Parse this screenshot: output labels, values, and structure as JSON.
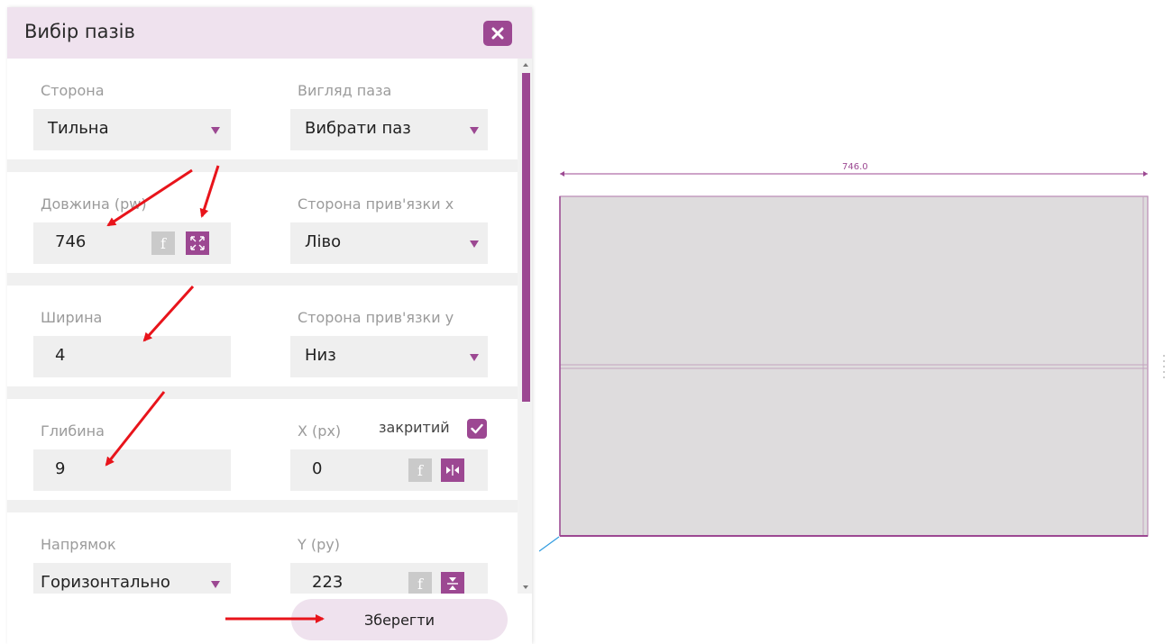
{
  "dialog": {
    "title": "Вибір пазів",
    "save_label": "Зберегти"
  },
  "fields": {
    "side": {
      "label": "Сторона",
      "value": "Тильна"
    },
    "groove_type": {
      "label": "Вигляд паза",
      "value": "Вибрати паз"
    },
    "length": {
      "label": "Довжина (pw)",
      "value": "746"
    },
    "anchor_x": {
      "label": "Сторона прив'язки x",
      "value": "Ліво"
    },
    "width": {
      "label": "Ширина",
      "value": "4"
    },
    "anchor_y": {
      "label": "Сторона прив'язки y",
      "value": "Низ"
    },
    "depth": {
      "label": "Глибина",
      "value": "9"
    },
    "x": {
      "label": "X (px)",
      "value": "0"
    },
    "closed": {
      "label": "закритий",
      "checked": true
    },
    "direction": {
      "label": "Напрямок",
      "value": "Горизонтально"
    },
    "y": {
      "label": "Y (py)",
      "value": "223"
    }
  },
  "buttons": {
    "formula_label": "f"
  },
  "preview": {
    "dimension_label": "746.0"
  },
  "colors": {
    "accent": "#9c4892",
    "header_bg": "#efe2ee",
    "field_bg": "#efefef",
    "panel_fill": "#dedcdd",
    "annotation": "#e8141b"
  }
}
